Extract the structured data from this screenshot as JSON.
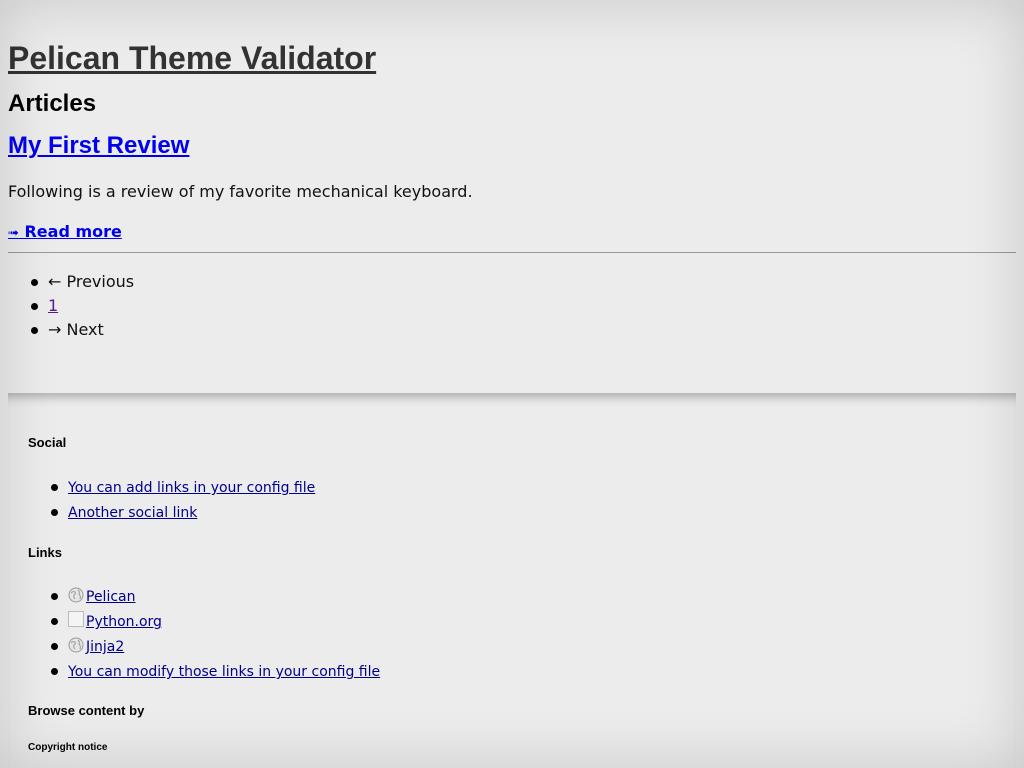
{
  "header": {
    "site_title": "Pelican Theme Validator",
    "section_heading": "Articles"
  },
  "article": {
    "title": "My First Review",
    "summary": "Following is a review of my favorite mechanical keyboard.",
    "read_more_arrow": "➟",
    "read_more_label": "Read more"
  },
  "pagination": {
    "previous_label": "← Previous",
    "current_page": "1",
    "next_label": "→ Next"
  },
  "footer": {
    "social": {
      "title": "Social",
      "links": [
        "You can add links in your config file",
        "Another social link"
      ]
    },
    "links": {
      "title": "Links",
      "items": [
        {
          "icon": "globe-icon",
          "label": "Pelican"
        },
        {
          "icon": "broken-image-icon",
          "label": "Python.org"
        },
        {
          "icon": "globe-icon",
          "label": "Jinja2"
        },
        {
          "icon": "",
          "label": "You can modify those links in your config file"
        }
      ]
    },
    "browse_title": "Browse content by",
    "copyright_title": "Copyright notice"
  },
  "colors": {
    "background": "#ececec",
    "link": "#0000ee",
    "visited_link": "#551a8b",
    "footer_link": "#00008b",
    "title_text": "#333333"
  }
}
